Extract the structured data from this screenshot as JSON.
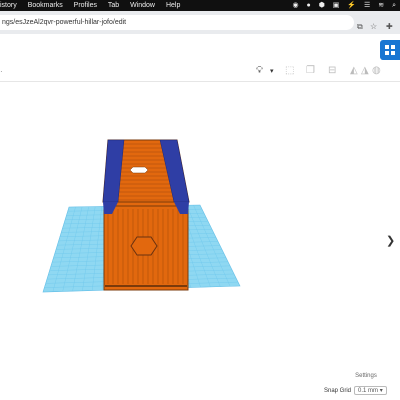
{
  "menubar": {
    "items": [
      "istory",
      "Bookmarks",
      "Profiles",
      "Tab",
      "Window",
      "Help"
    ]
  },
  "url": "ngs/esJzeAl2qvr-powerful-hillar-jofo/edit",
  "sidebar": {
    "chevron": "❯"
  },
  "settings_label": "Settings",
  "snap_grid": {
    "label": "Snap Grid",
    "value": "0.1 mm"
  },
  "icons": {
    "status": [
      "chat-icon",
      "record-icon",
      "shield-icon",
      "app-icon",
      "bolt-icon",
      "menu-icon",
      "wifi-icon",
      "search-icon"
    ],
    "toolbar": [
      "bulb-icon",
      "chevron-down-icon",
      "shape-icon",
      "group-icon",
      "align-icon",
      "mirror-icon",
      "flip-icon",
      "cruise-icon"
    ]
  },
  "colors": {
    "container": "#e2680e",
    "stripe": "#2f3ea5",
    "workplane": "#8fd8f2",
    "grid_line": "#62bde6",
    "accent": "#1976d2"
  }
}
